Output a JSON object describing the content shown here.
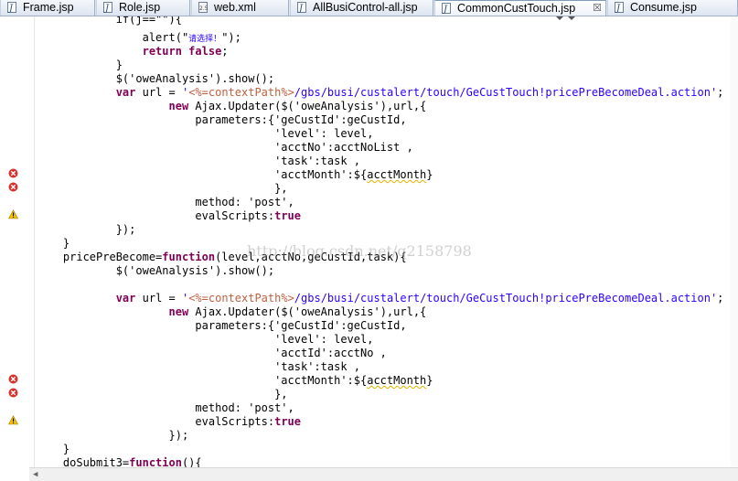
{
  "tabs": [
    {
      "label": "Frame.jsp",
      "icon": "jsp-file-icon"
    },
    {
      "label": "Role.jsp",
      "icon": "jsp-file-icon"
    },
    {
      "label": "web.xml",
      "icon": "xml-file-icon"
    },
    {
      "label": "AllBusiControl-all.jsp",
      "icon": "jsp-file-icon"
    },
    {
      "label": "CommonCustTouch.jsp",
      "icon": "jsp-file-icon",
      "active": true,
      "close": "☒"
    },
    {
      "label": "Consume.jsp",
      "icon": "jsp-file-icon"
    }
  ],
  "code": {
    "l0_pre": "            ",
    "l0_text": "if(j==\"\"){",
    "l1_pre": "                alert(\"",
    "l1_cn": "请选择！",
    "l1_post": "\");",
    "l2_kw": "return false",
    "l2_post": ";",
    "l3": "            }",
    "l4": "            $('oweAnalysis').show();",
    "l5_kw": "var",
    "l5_mid": " url = ",
    "l5_q": "'",
    "l5_jsp": "<%=contextPath%>",
    "l5_str": "/gbs/busi/custalert/touch/GeCustTouch!pricePreBecomeDeal.action'",
    "l5_end": ";",
    "l6_kw": "new",
    "l6_post": " Ajax.Updater($('oweAnalysis'),url,{",
    "l7": "                        parameters:{'geCustId':geCustId,",
    "l8": "                                    'level': level,",
    "l9": "                                    'acctNo':acctNoList ,",
    "l10": "                                    'task':task ,",
    "l11_pre": "                                    'acctMonth':${",
    "l11_sq": "acctMonth",
    "l11_post": "}",
    "l12": "                                    },",
    "l13": "                        method: 'post',",
    "l14_pre": "                        evalScripts:",
    "l14_kw": "true",
    "l15": "            });",
    "l16": "    }",
    "l17_pre": "    pricePreBecome=",
    "l17_kw": "function",
    "l17_post": "(level,acctNo,geCustId,task){",
    "l18": "            $('oweAnalysis').show();",
    "l20_kw": "var",
    "l20_mid": " url = ",
    "l20_q": "'",
    "l20_jsp": "<%=contextPath%>",
    "l20_str": "/gbs/busi/custalert/touch/GeCustTouch!pricePreBecomeDeal.action'",
    "l20_end": ";",
    "l21_kw": "new",
    "l21_post": " Ajax.Updater($('oweAnalysis'),url,{",
    "l22": "                        parameters:{'geCustId':geCustId,",
    "l23": "                                    'level': level,",
    "l24": "                                    'acctId':acctNo ,",
    "l25": "                                    'task':task ,",
    "l26_pre": "                                    'acctMonth':${",
    "l26_sq": "acctMonth",
    "l26_post": "}",
    "l27": "                                    },",
    "l28": "                        method: 'post',",
    "l29_pre": "                        evalScripts:",
    "l29_kw": "true",
    "l30": "                    });",
    "l31": "    }",
    "l32_pre": "    doSubmit3=",
    "l32_kw": "function",
    "l32_post": "(){"
  },
  "watermark": "http://blog.csdn.net/q2158798",
  "colors": {
    "keyword": "#7f0055",
    "string": "#2a00ff",
    "jsp": "#bf5f3f",
    "error": "#d9302c",
    "warning": "#e8b200"
  }
}
